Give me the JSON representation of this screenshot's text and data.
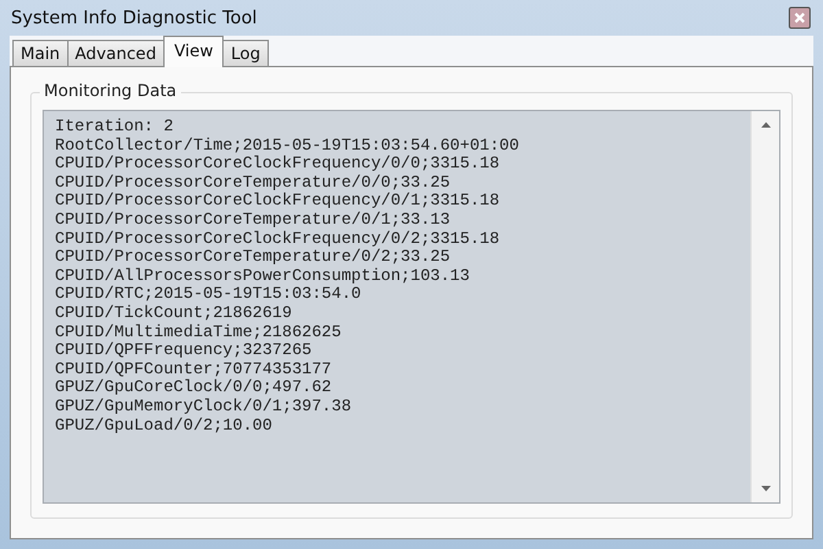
{
  "window": {
    "title": "System Info Diagnostic Tool"
  },
  "tabs": [
    {
      "label": "Main",
      "selected": false
    },
    {
      "label": "Advanced",
      "selected": false
    },
    {
      "label": "View",
      "selected": true
    },
    {
      "label": "Log",
      "selected": false
    }
  ],
  "group": {
    "title": "Monitoring Data",
    "lines": [
      "Iteration: 2",
      "RootCollector/Time;2015-05-19T15:03:54.60+01:00",
      "CPUID/ProcessorCoreClockFrequency/0/0;3315.18",
      "CPUID/ProcessorCoreTemperature/0/0;33.25",
      "CPUID/ProcessorCoreClockFrequency/0/1;3315.18",
      "CPUID/ProcessorCoreTemperature/0/1;33.13",
      "CPUID/ProcessorCoreClockFrequency/0/2;3315.18",
      "CPUID/ProcessorCoreTemperature/0/2;33.25",
      "CPUID/AllProcessorsPowerConsumption;103.13",
      "CPUID/RTC;2015-05-19T15:03:54.0",
      "CPUID/TickCount;21862619",
      "CPUID/MultimediaTime;21862625",
      "CPUID/QPFFrequency;3237265",
      "CPUID/QPFCounter;70774353177",
      "GPUZ/GpuCoreClock/0/0;497.62",
      "GPUZ/GpuMemoryClock/0/1;397.38",
      "GPUZ/GpuLoad/0/2;10.00"
    ]
  }
}
